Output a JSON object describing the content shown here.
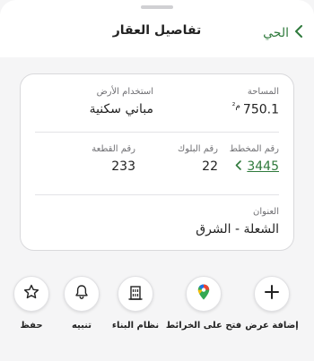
{
  "header": {
    "title": "تفاصيل العقار",
    "back_label": "الحي"
  },
  "details": {
    "area": {
      "label": "المساحة",
      "value": "750.1",
      "unit": "م²"
    },
    "land_use": {
      "label": "استخدام الأرض",
      "value": "مباني سكنية"
    },
    "plan_number": {
      "label": "رقم المخطط",
      "value": "3445"
    },
    "block_number": {
      "label": "رقم البلوك",
      "value": "22"
    },
    "parcel_number": {
      "label": "رقم القطعة",
      "value": "233"
    },
    "address": {
      "label": "العنوان",
      "value": "الشعلة - الشرق"
    }
  },
  "actions": {
    "add_offer": "إضافة عرض",
    "open_maps": "فتح على الخرائط",
    "building_system": "نظام البناء",
    "alert": "تنبيه",
    "save": "حفظ"
  },
  "colors": {
    "accent_green": "#2f7a3c",
    "background": "#f5f5f6",
    "card_border": "#d9d9dc"
  },
  "icons": {
    "back": "chevron-left-icon",
    "plan_link": "chevron-left-icon",
    "add_offer": "plus-icon",
    "open_maps": "google-maps-pin-icon",
    "building_system": "building-icon",
    "alert": "bell-icon",
    "save": "star-icon"
  }
}
